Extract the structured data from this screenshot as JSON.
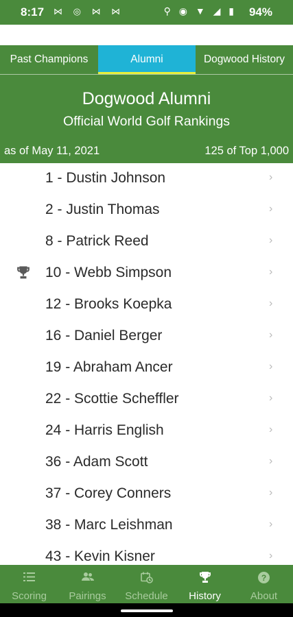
{
  "status_bar": {
    "time": "8:17",
    "notif_icons": "⋈ ◎ ⋈ ⋈",
    "system_icons": "⚲ ◉ ▼ ◢ ▮",
    "battery": "94%"
  },
  "tabs": [
    {
      "label": "Past Champions",
      "active": false
    },
    {
      "label": "Alumni",
      "active": true
    },
    {
      "label": "Dogwood History",
      "active": false
    }
  ],
  "header": {
    "title": "Dogwood Alumni",
    "subtitle": "Official World Golf Rankings",
    "date": "as of May 11, 2021",
    "count": "125 of Top 1,000"
  },
  "rankings": [
    {
      "label": "1 - Dustin Johnson",
      "trophy": false
    },
    {
      "label": "2 - Justin Thomas",
      "trophy": false
    },
    {
      "label": "8 - Patrick Reed",
      "trophy": false
    },
    {
      "label": "10 - Webb Simpson",
      "trophy": true
    },
    {
      "label": "12 - Brooks Koepka",
      "trophy": false
    },
    {
      "label": "16 - Daniel Berger",
      "trophy": false
    },
    {
      "label": "19 - Abraham Ancer",
      "trophy": false
    },
    {
      "label": "22 - Scottie Scheffler",
      "trophy": false
    },
    {
      "label": "24 - Harris English",
      "trophy": false
    },
    {
      "label": "36 - Adam Scott",
      "trophy": false
    },
    {
      "label": "37 - Corey Conners",
      "trophy": false
    },
    {
      "label": "38 - Marc Leishman",
      "trophy": false
    },
    {
      "label": "43 - Kevin Kisner",
      "trophy": false
    }
  ],
  "chevron": "›",
  "bottom_nav": [
    {
      "label": "Scoring",
      "icon": "list-icon",
      "active": false
    },
    {
      "label": "Pairings",
      "icon": "people-icon",
      "active": false
    },
    {
      "label": "Schedule",
      "icon": "calendar-clock-icon",
      "active": false
    },
    {
      "label": "History",
      "icon": "trophy-icon",
      "active": true
    },
    {
      "label": "About",
      "icon": "help-circle-icon",
      "active": false
    }
  ],
  "colors": {
    "primary_green": "#4a8a3c",
    "active_tab": "#1fb3d6",
    "tab_underline": "#e6ef3a"
  }
}
